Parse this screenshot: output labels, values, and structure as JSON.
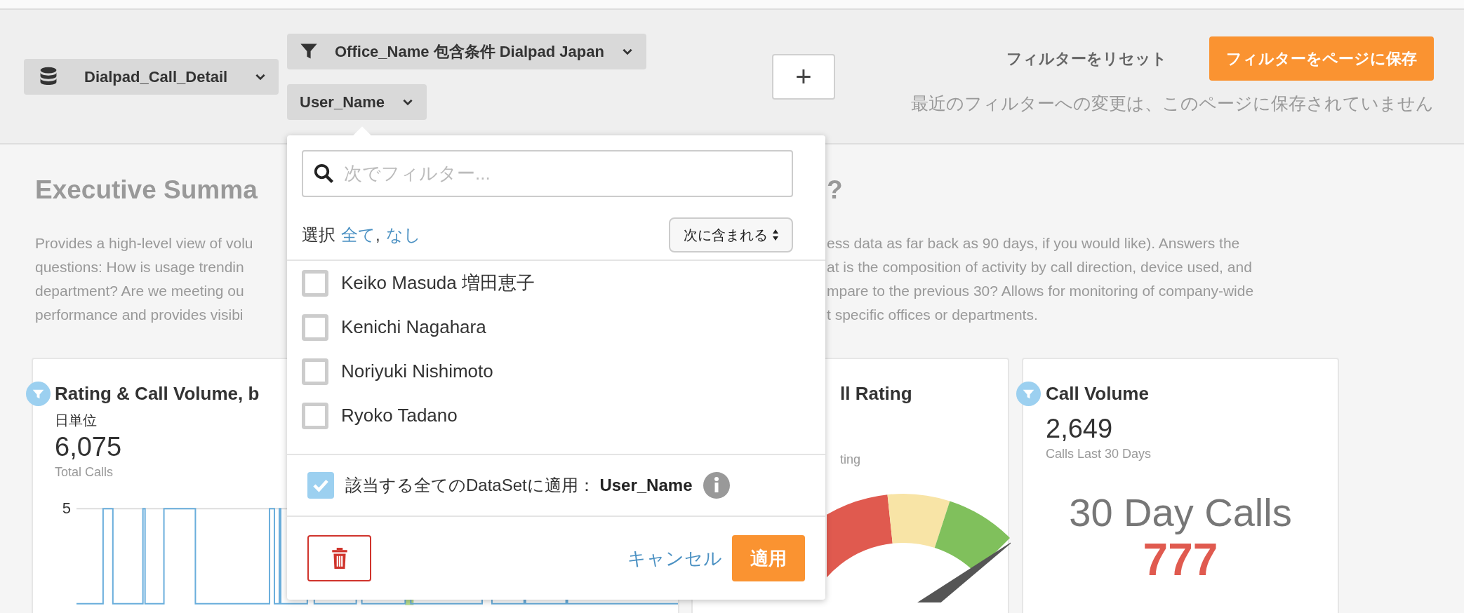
{
  "filter_bar": {
    "dataset": {
      "label": "Dialpad_Call_Detail"
    },
    "filters": [
      {
        "label": "Office_Name 包含条件 Dialpad Japan",
        "kind": "funnel"
      },
      {
        "label": "User_Name",
        "kind": "plain"
      }
    ],
    "add_button": "+",
    "reset_link": "フィルターをリセット",
    "save_button": "フィルターをページに保存",
    "unsaved_notice": "最近のフィルターへの変更は、このページに保存されていません"
  },
  "page": {
    "title_left": "Executive Summa",
    "title_right": "?",
    "description_left": [
      "Provides a high-level view of volu",
      "questions: How is usage trendin",
      "department? Are we meeting ou",
      "performance and provides visibi"
    ],
    "description_right": [
      "ess data as far back as 90 days, if you would like). Answers the",
      "at is the composition of activity by call direction, device used, and",
      "mpare to the previous 30? Allows for monitoring of company-wide",
      "t specific offices or departments."
    ]
  },
  "cards": [
    {
      "kind": "trend",
      "title": "Rating & Call Volume, b",
      "filtered": true,
      "subtitle": "日単位",
      "value": "6,075",
      "caption": "Total Calls",
      "axis_label": "5"
    },
    {
      "kind": "gauge",
      "title": "ll Rating",
      "caption": "ting"
    },
    {
      "kind": "volume",
      "title": "Call Volume",
      "filtered": true,
      "value": "2,649",
      "caption": "Calls Last 30 Days",
      "big_label": "30 Day Calls",
      "big_value": "777"
    }
  ],
  "popover": {
    "search": {
      "placeholder": "次でフィルター..."
    },
    "select_label": "選択",
    "select_all": "全て",
    "separator": ",",
    "select_none": "なし",
    "mode": "次に含まれる",
    "options": [
      {
        "label": "Keiko Masuda 増田恵子",
        "checked": false
      },
      {
        "label": "Kenichi Nagahara",
        "checked": false
      },
      {
        "label": "Noriyuki Nishimoto",
        "checked": false
      },
      {
        "label": "Ryoko Tadano",
        "checked": false
      }
    ],
    "apply_all": {
      "checked": true,
      "label": "該当する全てのDataSetに適用：",
      "field": "User_Name"
    },
    "cancel": "キャンセル",
    "apply": "適用"
  }
}
